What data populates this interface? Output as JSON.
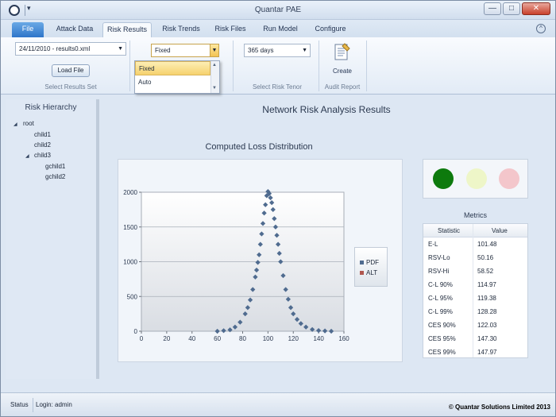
{
  "window": {
    "title": "Quantar PAE",
    "qat_dropdown": "▾",
    "minimize": "—",
    "maximize": "□",
    "close": "✕"
  },
  "ribbon_tabs": [
    "File",
    "Attack Data",
    "Risk Results",
    "Risk Trends",
    "Risk Files",
    "Run Model",
    "Configure"
  ],
  "active_tab": "Risk Results",
  "help_icon": "^",
  "ribbon": {
    "results_set": {
      "value": "24/11/2010 - results0.xml",
      "load_button": "Load File",
      "group_label": "Select Results Set"
    },
    "mode": {
      "value": "Fixed",
      "options": [
        "Fixed",
        "Auto"
      ],
      "highlighted": "Fixed"
    },
    "tenor": {
      "value": "365 days",
      "group_label": "Select Risk Tenor"
    },
    "audit": {
      "create_label": "Create",
      "group_label": "Audit Report",
      "icon": "document-create-icon"
    }
  },
  "risk_hierarchy": {
    "title": "Risk Hierarchy",
    "nodes": [
      {
        "label": "root",
        "level": 0,
        "expanded": true
      },
      {
        "label": "child1",
        "level": 1
      },
      {
        "label": "child2",
        "level": 1
      },
      {
        "label": "child3",
        "level": 1,
        "expanded": true
      },
      {
        "label": "gchild1",
        "level": 2
      },
      {
        "label": "gchild2",
        "level": 2
      }
    ]
  },
  "main_title": "Network Risk Analysis Results",
  "chart_data": {
    "type": "scatter",
    "title": "Computed Loss Distribution",
    "xlabel": "",
    "ylabel": "",
    "xlim": [
      0,
      160
    ],
    "ylim": [
      0,
      2000
    ],
    "x_ticks": [
      0,
      20,
      40,
      60,
      80,
      100,
      120,
      140,
      160
    ],
    "y_ticks": [
      0,
      500,
      1000,
      1500,
      2000
    ],
    "grid": true,
    "legend_position": "right",
    "series": [
      {
        "name": "PDF",
        "color": "#4f6b8f",
        "x": [
          60,
          65,
          70,
          74,
          78,
          82,
          84,
          86,
          88,
          90,
          91,
          92,
          93,
          94,
          95,
          96,
          97,
          98,
          99,
          100,
          101,
          102,
          103,
          104,
          105,
          106,
          107,
          108,
          109,
          110,
          112,
          114,
          116,
          118,
          120,
          123,
          126,
          130,
          135,
          140,
          145,
          150
        ],
        "y": [
          0,
          8,
          20,
          60,
          130,
          250,
          340,
          450,
          600,
          780,
          880,
          990,
          1100,
          1250,
          1400,
          1550,
          1700,
          1820,
          1950,
          2010,
          1980,
          1920,
          1850,
          1750,
          1620,
          1500,
          1380,
          1250,
          1120,
          1000,
          800,
          600,
          460,
          340,
          250,
          170,
          110,
          60,
          25,
          10,
          4,
          0
        ]
      },
      {
        "name": "ALT",
        "color": "#b0574f",
        "x": [],
        "y": []
      }
    ]
  },
  "lights": {
    "green": "#0d7a0d",
    "amber": "#eef6c8",
    "red": "#f3c6cb"
  },
  "metrics": {
    "title": "Metrics",
    "headers": [
      "Statistic",
      "Value"
    ],
    "rows": [
      [
        "E-L",
        "101.48"
      ],
      [
        "RSV-Lo",
        "50.16"
      ],
      [
        "RSV-Hi",
        "58.52"
      ],
      [
        "C-L 90%",
        "114.97"
      ],
      [
        "C-L 95%",
        "119.38"
      ],
      [
        "C-L 99%",
        "128.28"
      ],
      [
        "CES 90%",
        "122.03"
      ],
      [
        "CES 95%",
        "147.30"
      ],
      [
        "CES 99%",
        "147.97"
      ]
    ]
  },
  "statusbar": {
    "status": "Status",
    "login": "Login: admin",
    "copyright": "© Quantar Solutions Limited 2013"
  }
}
